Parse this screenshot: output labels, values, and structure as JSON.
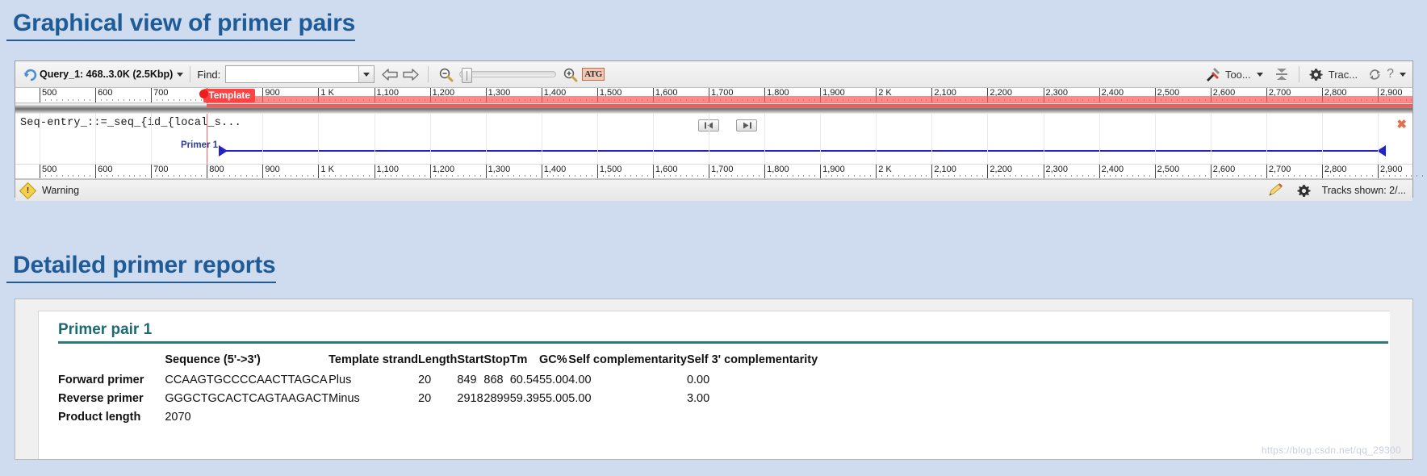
{
  "headings": {
    "graphical": "Graphical view of primer pairs",
    "detailed": "Detailed primer reports"
  },
  "viewer": {
    "toolbar": {
      "back_icon": "undo-icon",
      "query_label": "Query_1: 468..3.0K (2.5Kbp)",
      "find_label": "Find:",
      "find_value": "",
      "find_placeholder": "",
      "prev_icon": "arrow-left-icon",
      "next_icon": "arrow-right-icon",
      "zoom_out_icon": "zoom-out-icon",
      "zoom_in_icon": "zoom-in-icon",
      "atg_label": "ATG",
      "tools_label": "Too...",
      "align_icon": "align-icon",
      "tracks_label": "Trac...",
      "reload_icon": "reload-icon",
      "help_label": "?"
    },
    "ruler_ticks": [
      "500",
      "600",
      "700",
      "800",
      "900",
      "1 K",
      "1,100",
      "1,200",
      "1,300",
      "1,400",
      "1,500",
      "1,600",
      "1,700",
      "1,800",
      "1,900",
      "2 K",
      "2,100",
      "2,200",
      "2,300",
      "2,400",
      "2,500",
      "2,600",
      "2,700",
      "2,800",
      "2,900"
    ],
    "template_tag": "Template",
    "sequence_label": "Seq-entry_::=_seq_{id_{local_s...",
    "nav_prev_icon": "skip-prev-icon",
    "nav_next_icon": "skip-next-icon",
    "close_icon": "close-icon",
    "primer_label": "Primer 1",
    "status": {
      "warning_icon": "warning-icon",
      "warning_text": "Warning",
      "edit_icon": "pencil-icon",
      "gear_icon": "gear-icon",
      "tracks_shown": "Tracks shown: 2/..."
    },
    "colors": {
      "accent_blue": "#1f5b96",
      "template_red": "#ff4242",
      "primer_blue": "#2323c8"
    }
  },
  "report": {
    "pair_title": "Primer pair 1",
    "columns": {
      "rowhdr": "",
      "sequence": "Sequence (5'->3')",
      "strand": "Template strand",
      "length": "Length",
      "start": "Start",
      "stop": "Stop",
      "tm": "Tm",
      "gc": "GC%",
      "self_comp": "Self complementarity",
      "self3_comp": "Self 3' complementarity"
    },
    "rows": [
      {
        "label": "Forward primer",
        "sequence": "CCAAGTGCCCCAACTTAGCA",
        "strand": "Plus",
        "length": "20",
        "start": "849",
        "stop": "868",
        "tm": "60.54",
        "gc": "55.00",
        "self_comp": "4.00",
        "self3_comp": "0.00"
      },
      {
        "label": "Reverse primer",
        "sequence": "GGGCTGCACTCAGTAAGACT",
        "strand": "Minus",
        "length": "20",
        "start": "2918",
        "stop": "2899",
        "tm": "59.39",
        "gc": "55.00",
        "self_comp": "5.00",
        "self3_comp": "3.00"
      }
    ],
    "product_length_label": "Product length",
    "product_length_value": "2070"
  },
  "watermark": "https://blog.csdn.net/qq_29300"
}
